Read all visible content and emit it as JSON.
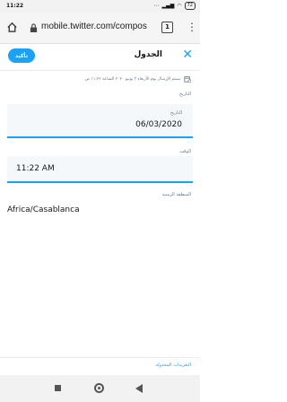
{
  "status_bar": {
    "time": "11:22",
    "battery": "72"
  },
  "browser": {
    "url": "mobile.twitter.com/compos",
    "tab_count": "1"
  },
  "header": {
    "confirm_label": "تأكيد",
    "title": "الجدول"
  },
  "schedule_note": "سيتم الإرسال يوم الأربعاء ٣ يونيو ٢٠٢٠ الساعة ١١:٢٢ ص",
  "date_section": {
    "label": "التاريخ",
    "field_label": "التاريخ",
    "value": "06/03/2020"
  },
  "time_section": {
    "label": "الوقت",
    "value": "11:22 AM"
  },
  "timezone_section": {
    "label": "المنطقة الزمنية",
    "value": "Africa/Casablanca"
  },
  "footer": {
    "link_label": "التغريدات المجدولة"
  },
  "colors": {
    "accent": "#1da1f2"
  }
}
